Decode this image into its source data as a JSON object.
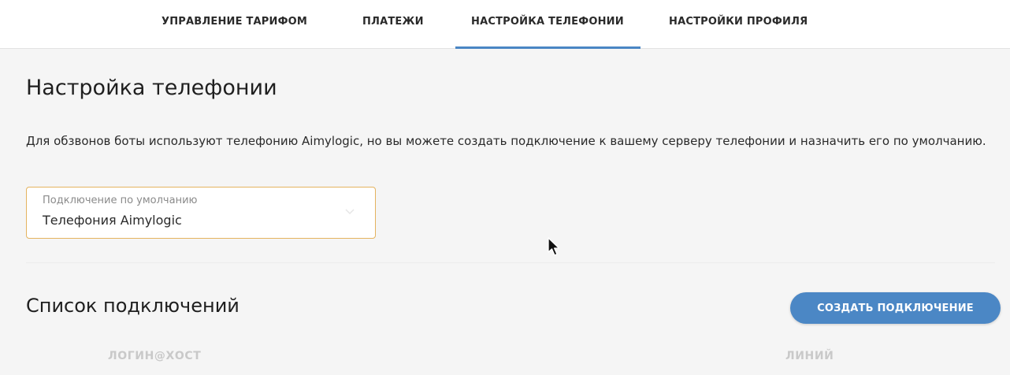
{
  "nav": {
    "tabs": [
      {
        "label": "УПРАВЛЕНИЕ ТАРИФОМ"
      },
      {
        "label": "ПЛАТЕЖИ"
      },
      {
        "label": "НАСТРОЙКА ТЕЛЕФОНИИ",
        "active": true
      },
      {
        "label": "НАСТРОЙКИ ПРОФИЛЯ"
      }
    ]
  },
  "page": {
    "title": "Настройка телефонии",
    "description": "Для обзвонов боты используют телефонию Aimylogic, но вы можете создать подключение к вашему серверу телефонии и назначить его по умолчанию."
  },
  "default_connection": {
    "label": "Подключение по умолчанию",
    "value": "Телефония Aimylogic",
    "icon": "chevron-down-icon"
  },
  "connections": {
    "title": "Список подключений",
    "create_button": "СОЗДАТЬ ПОДКЛЮЧЕНИЕ",
    "columns": [
      "ЛОГИН@ХОСТ",
      "ЛИНИЙ"
    ]
  },
  "colors": {
    "accent": "#4b87c5",
    "select_border": "#e4b35f",
    "background": "#f5f5f5"
  }
}
